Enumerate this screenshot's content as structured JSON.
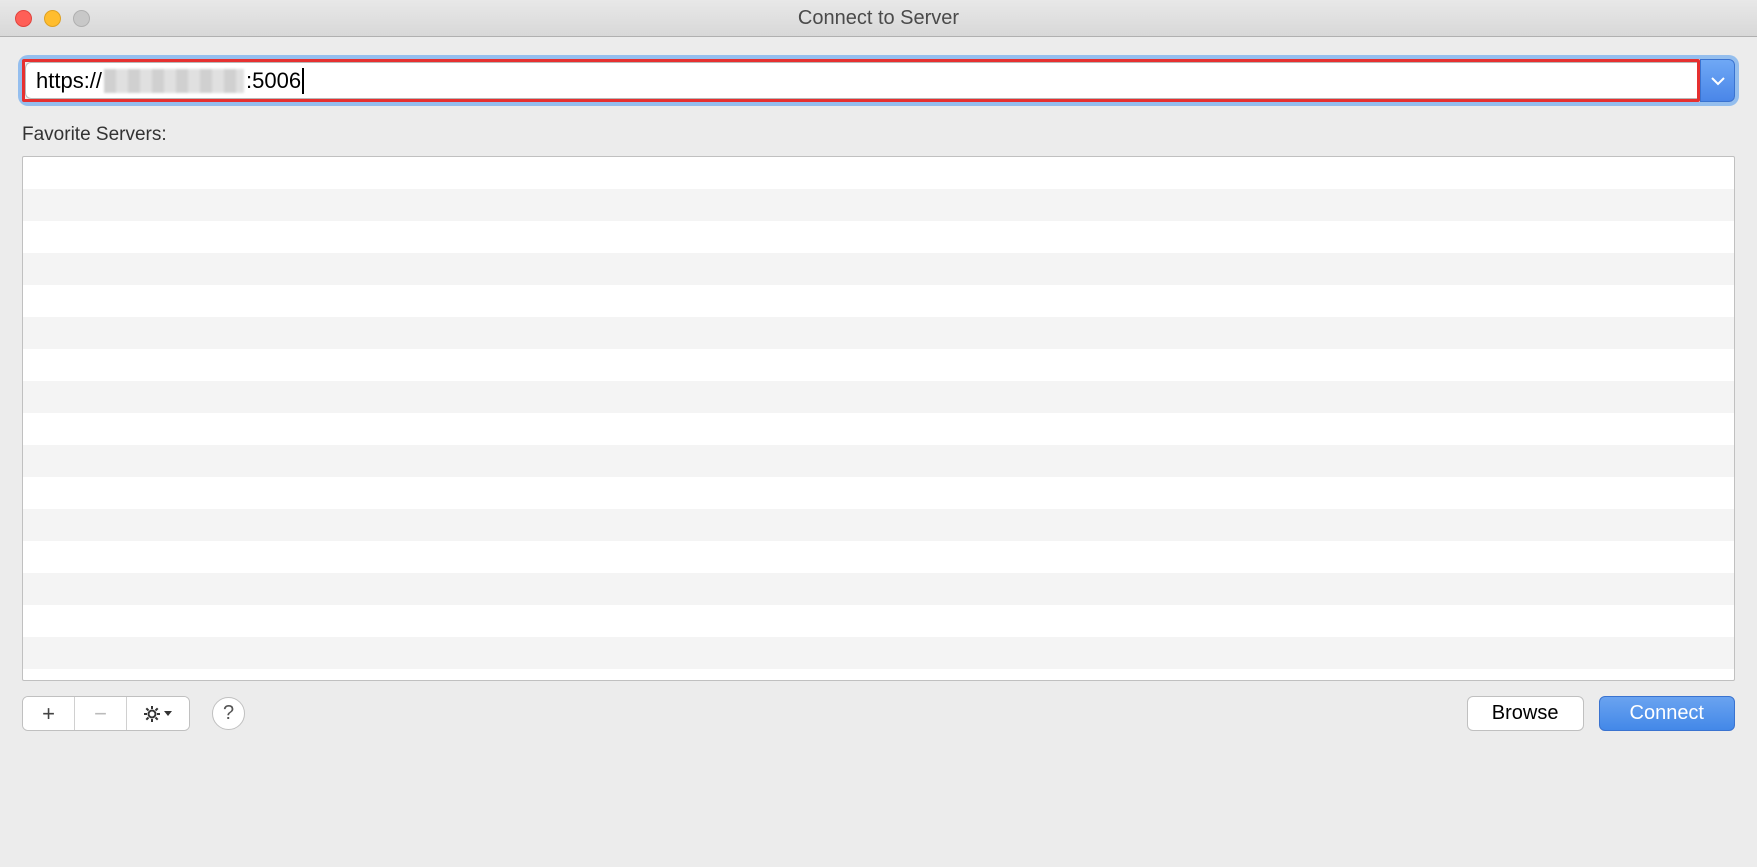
{
  "window": {
    "title": "Connect to Server"
  },
  "address": {
    "prefix": "https://",
    "port": ":5006"
  },
  "favorites": {
    "label": "Favorite Servers:",
    "row_count": 17
  },
  "toolbar": {
    "add": "+",
    "remove": "−",
    "help": "?"
  },
  "buttons": {
    "browse": "Browse",
    "connect": "Connect"
  }
}
